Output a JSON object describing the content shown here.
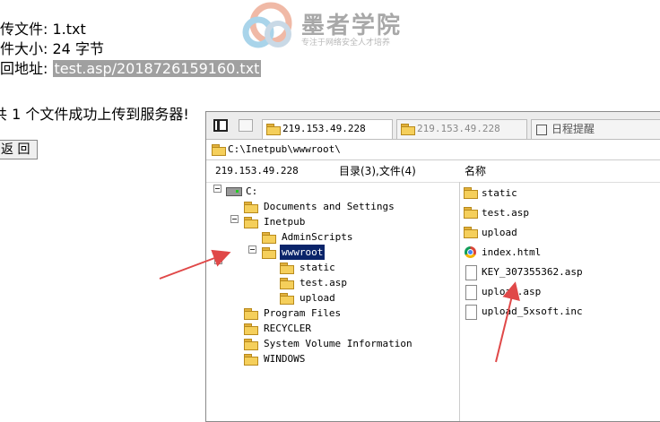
{
  "upload": {
    "filename_label": "上传文件:",
    "filename": "1.txt",
    "size_label": "文件大小:",
    "size": "24 字节",
    "address_label": "返回地址:",
    "address": "test.asp/2018726159160.txt",
    "message": "共 1 个文件成功上传到服务器!",
    "back_button": "返 回"
  },
  "watermark": {
    "title": "墨者学院",
    "subtitle": "专注于网络安全人才培养"
  },
  "file_manager": {
    "tabs": [
      {
        "label": "219.153.49.228",
        "active": true
      },
      {
        "label": "219.153.49.228",
        "active": false
      },
      {
        "label": "日程提醒",
        "active": false
      }
    ],
    "path": "C:\\Inetpub\\wwwroot\\",
    "header": {
      "ip": "219.153.49.228",
      "counts": "目录(3),文件(4)",
      "name_column": "名称"
    },
    "tree": [
      {
        "label": "C:",
        "type": "drive",
        "depth": 0,
        "expanded": true
      },
      {
        "label": "Documents and Settings",
        "type": "folder",
        "depth": 1
      },
      {
        "label": "Inetpub",
        "type": "folder",
        "depth": 1,
        "expanded": true
      },
      {
        "label": "AdminScripts",
        "type": "folder",
        "depth": 2
      },
      {
        "label": "wwwroot",
        "type": "folder",
        "depth": 2,
        "expanded": true,
        "selected": true
      },
      {
        "label": "static",
        "type": "folder",
        "depth": 3
      },
      {
        "label": "test.asp",
        "type": "folder",
        "depth": 3
      },
      {
        "label": "upload",
        "type": "folder",
        "depth": 3
      },
      {
        "label": "Program Files",
        "type": "folder",
        "depth": 1
      },
      {
        "label": "RECYCLER",
        "type": "folder",
        "depth": 1
      },
      {
        "label": "System Volume Information",
        "type": "folder",
        "depth": 1
      },
      {
        "label": "WINDOWS",
        "type": "folder",
        "depth": 1
      }
    ],
    "files": [
      {
        "label": "static",
        "icon": "folder-icon"
      },
      {
        "label": "test.asp",
        "icon": "folder-icon"
      },
      {
        "label": "upload",
        "icon": "folder-icon"
      },
      {
        "label": "index.html",
        "icon": "chrome-icon"
      },
      {
        "label": "KEY_307355362.asp",
        "icon": "file-icon"
      },
      {
        "label": "upload.asp",
        "icon": "file-icon"
      },
      {
        "label": "upload_5xsoft.inc",
        "icon": "file-icon"
      }
    ]
  },
  "colors": {
    "annotation_arrow": "#e04848",
    "selection": "#0a246a",
    "folder": "#f5cf5b"
  }
}
